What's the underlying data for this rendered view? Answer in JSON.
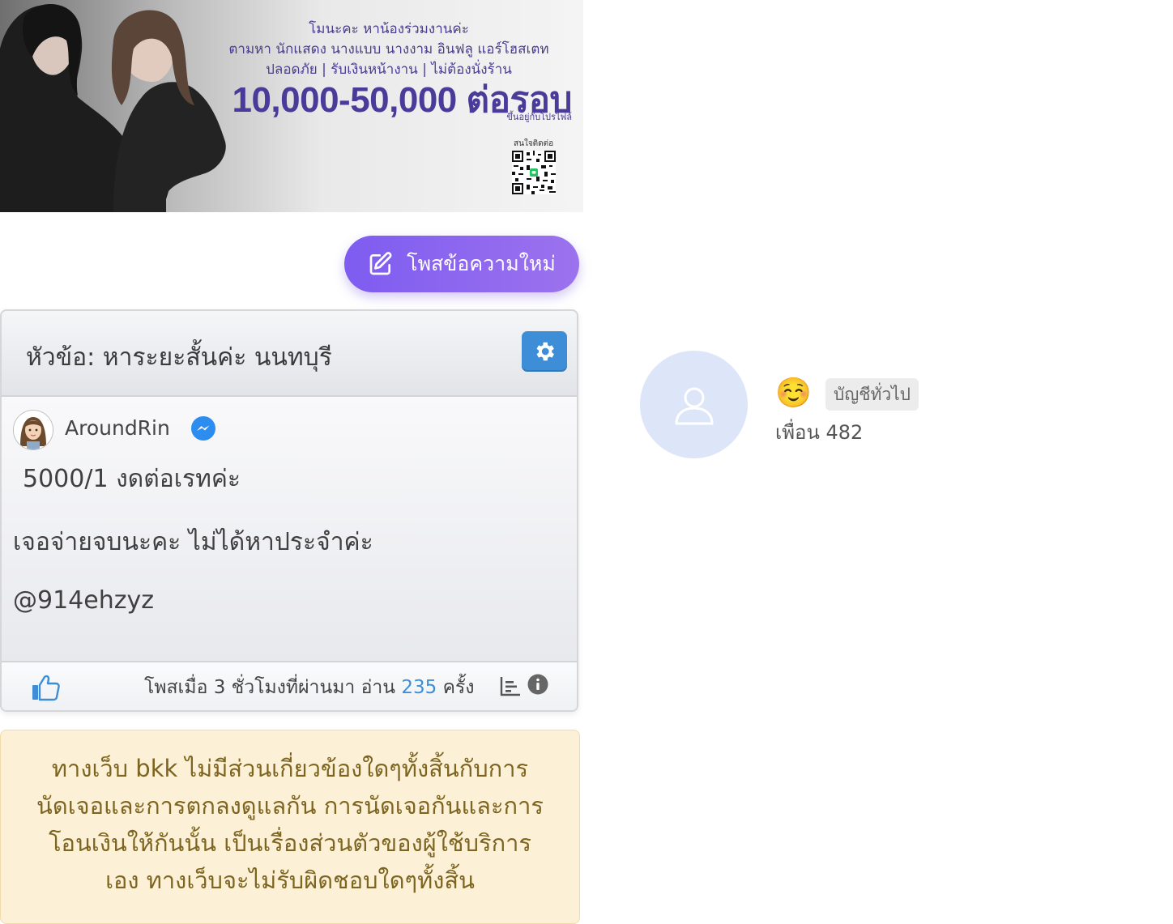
{
  "banner": {
    "line1": "โมนะคะ หาน้องร่วมงานค่ะ",
    "line2": "ตามหา นักแสดง นางแบบ นางงาม อินฟลู แอร์โฮสเตท",
    "line3": "ปลอดภัย | รับเงินหน้างาน | ไม่ต้องนั่งร้าน",
    "price": "10,000-50,000 ต่อรอบ",
    "note": "ขึ้นอยู่กับโปรไฟล์",
    "contact": "สนใจติดต่อ"
  },
  "toolbar": {
    "new_post_label": "โพสข้อความใหม่"
  },
  "post": {
    "title": "หัวข้อ: หาระยะสั้นค่ะ นนทบุรี",
    "author": "AroundRin",
    "lines": [
      "5000/1 งดต่อเรทค่ะ",
      "เจอจ่ายจบนะคะ ไม่ได้หาประจำค่ะ",
      "@914ehzyz"
    ],
    "meta_prefix": "โพสเมื่อ 3 ชั่วโมงที่ผ่านมา อ่าน",
    "read_count": "235",
    "meta_suffix": "ครั้ง"
  },
  "disclaimer": {
    "lines": [
      "ทางเว็บ bkk ไม่มีส่วนเกี่ยวข้องใดๆทั้งสิ้นกับการ",
      "นัดเจอและการตกลงดูแลกัน การนัดเจอกันและการ",
      "โอนเงินให้กันนั้น เป็นเรื่องส่วนตัวของผู้ใช้บริการ",
      "เอง ทางเว็บจะไม่รับผิดชอบใดๆทั้งสิ้น"
    ]
  },
  "profile": {
    "emoji": "☺️",
    "account_type": "บัญชีทั่วไป",
    "friends_label": "เพื่อน 482"
  },
  "colors": {
    "accent_purple": "#8a64f0",
    "settings_blue": "#3d8ed6",
    "read_count_blue": "#3d8ed6",
    "disclaimer_bg": "#fcf1d6",
    "disclaimer_text": "#7d6420",
    "banner_text": "#4a3b9a"
  },
  "icons": {
    "new_post": "edit-icon",
    "settings": "gear-icon",
    "messenger": "messenger-icon",
    "like": "thumbs-up-icon",
    "stats": "stats-icon",
    "info": "info-icon",
    "profile_avatar": "user-icon"
  }
}
